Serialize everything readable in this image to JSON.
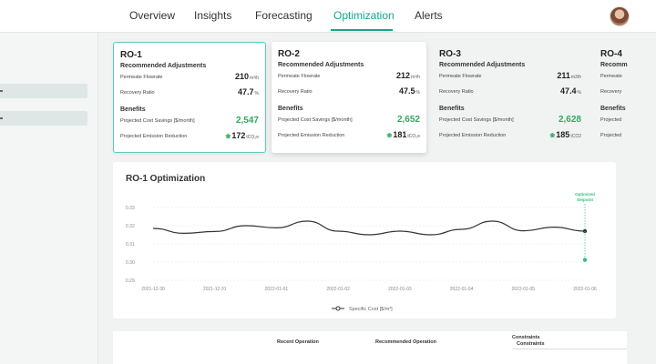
{
  "nav": {
    "tabs": [
      {
        "label": "Overview"
      },
      {
        "label": "Insights"
      },
      {
        "label": "Forecasting"
      },
      {
        "label": "Optimization",
        "active": true
      },
      {
        "label": "Alerts"
      }
    ]
  },
  "cards": [
    {
      "title": "RO-1",
      "adjust_title": "Recommended Adjustments",
      "flow_label": "Permeate Flowrate",
      "flow_value": "210",
      "flow_unit": "m³/h",
      "rec_label": "Recovery Ratio",
      "rec_value": "47.7",
      "rec_unit": "%",
      "benefits_title": "Benefits",
      "cost_label": "Projected Cost Savings [$/month]",
      "cost_value": "2,547",
      "em_label": "Projected Emission Reduction",
      "em_value": "172",
      "em_unit": "tCO₂e"
    },
    {
      "title": "RO-2",
      "adjust_title": "Recommended Adjustments",
      "flow_label": "Permeate Flowrate",
      "flow_value": "212",
      "flow_unit": "m³/h",
      "rec_label": "Recovery Ratio",
      "rec_value": "47.5",
      "rec_unit": "%",
      "benefits_title": "Benefits",
      "cost_label": "Projected Cost Savings [$/month]",
      "cost_value": "2,652",
      "em_label": "Projected Emission Reduction",
      "em_value": "181",
      "em_unit": "tCO₂e"
    },
    {
      "title": "RO-3",
      "adjust_title": "Recommended Adjustments",
      "flow_label": "Permeate Flowrate",
      "flow_value": "211",
      "flow_unit": "m3/h",
      "rec_label": "Recovery Ratio",
      "rec_value": "47.4",
      "rec_unit": "%",
      "benefits_title": "Benefits",
      "cost_label": "Projected Cost Savings [$/month]",
      "cost_value": "2,628",
      "em_label": "Projected Emission Reduction",
      "em_value": "185",
      "em_unit": "tCO2"
    },
    {
      "title": "RO-4",
      "adjust_title": "Recomm",
      "flow_label": "Permeate",
      "flow_value": "",
      "flow_unit": "",
      "rec_label": "Recovery",
      "rec_value": "",
      "rec_unit": "",
      "benefits_title": "Benefits",
      "cost_label": "Projected",
      "cost_value": "",
      "em_label": "Projected",
      "em_value": "",
      "em_unit": ""
    }
  ],
  "chart_data": {
    "type": "line",
    "title": "RO-1 Optimization",
    "x": [
      "2021-12-30",
      "2021-12-31",
      "2022-01-01",
      "2022-01-02",
      "2022-01-03",
      "2022-01-04",
      "2022-01-05",
      "2022-01-06"
    ],
    "yticks": [
      "0.33",
      "0.32",
      "0.31",
      "0.30",
      "0.29"
    ],
    "ylim": [
      0.29,
      0.33
    ],
    "series": [
      {
        "name": "Specific Cost [$/m³]",
        "color": "#333333",
        "points": [
          [
            "2021-12-30",
            0.3185
          ],
          [
            "2021-12-30T12",
            0.3158
          ],
          [
            "2021-12-31",
            0.3168
          ],
          [
            "2021-12-31T12",
            0.32
          ],
          [
            "2022-01-01",
            0.3188
          ],
          [
            "2022-01-01T12",
            0.3225
          ],
          [
            "2022-01-02",
            0.317
          ],
          [
            "2022-01-02T12",
            0.315
          ],
          [
            "2022-01-03",
            0.317
          ],
          [
            "2022-01-03T12",
            0.315
          ],
          [
            "2022-01-04",
            0.318
          ],
          [
            "2022-01-04T12",
            0.3225
          ],
          [
            "2022-01-05",
            0.3172
          ],
          [
            "2022-01-05T12",
            0.3192
          ],
          [
            "2022-01-06",
            0.317
          ]
        ]
      }
    ],
    "optimized_setpoint": {
      "label": [
        "Optimized",
        "Setpoint"
      ],
      "x": "2022-01-06",
      "y": 0.3012,
      "color": "#2ec27e"
    },
    "legend": "bottom-center",
    "grid": "horizontal-dashed"
  },
  "table": {
    "recent_label": "Recent Operation",
    "recommended_label": "Recommended Operation",
    "constraints_label": "Constraints"
  },
  "colors": {
    "accent": "#17a589",
    "selected_border": "#5fc9c1",
    "benefit_green": "#2eaa5f"
  }
}
